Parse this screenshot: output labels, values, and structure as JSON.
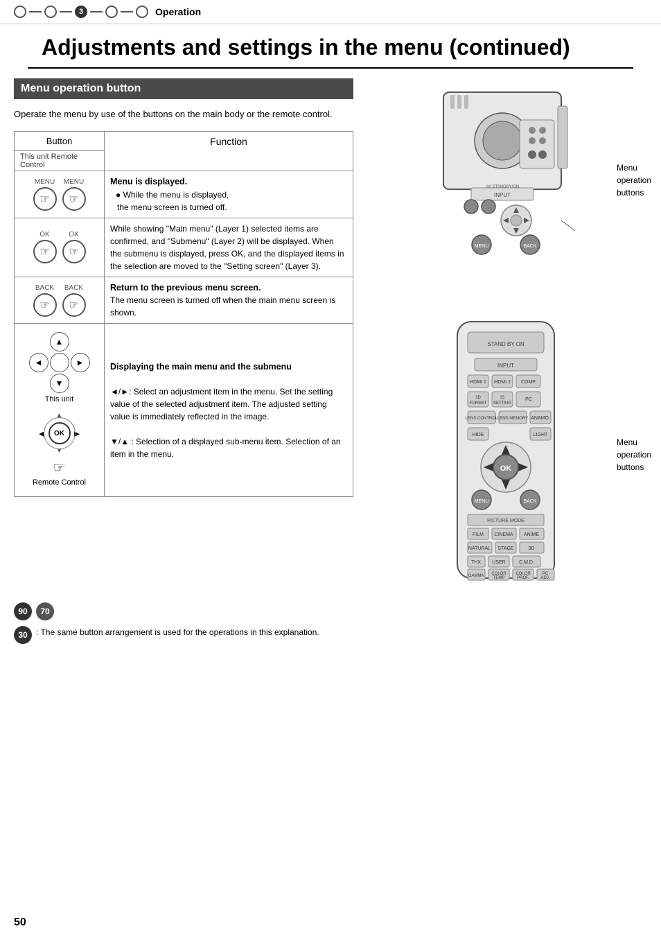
{
  "header": {
    "step_number": "3",
    "title": "Operation"
  },
  "page_title": "Adjustments and settings in the menu (continued)",
  "section_heading": "Menu operation button",
  "intro_text": "Operate the menu by use of the buttons on the main body or the remote control.",
  "table": {
    "col1_header": "Button",
    "col2_header": "Function",
    "sub_header": "This unit Remote Control",
    "rows": [
      {
        "id": "menu-row",
        "button_labels": [
          "MENU",
          "MENU"
        ],
        "function_title": "Menu is displayed.",
        "function_body": "● While the menu is displayed, the menu screen is turned off."
      },
      {
        "id": "ok-row",
        "button_labels": [
          "OK",
          "OK"
        ],
        "function_title": "",
        "function_body": "While showing \"Main menu\" (Layer 1) selected items are confirmed, and \"Submenu\" (Layer 2) will be displayed. When the submenu is displayed, press OK, and the displayed items in the selection are moved to the \"Setting screen\" (Layer 3)."
      },
      {
        "id": "back-row",
        "button_labels": [
          "BACK",
          "BACK"
        ],
        "function_title": "Return to the previous menu screen.",
        "function_body": "The menu screen is turned off when the main menu screen is shown."
      },
      {
        "id": "nav-row",
        "unit_label": "This unit",
        "remote_label": "Remote Control",
        "function_title": "Displaying the main menu and the submenu",
        "function_body_1": "◄/►: Select an adjustment item in the menu. Set the setting value of the selected adjustment item. The adjusted setting value is immediately reflected in the image.",
        "function_body_2": "▼/▲ : Selection of a displayed sub-menu item. Selection of an item in the menu."
      }
    ]
  },
  "right_diagrams": {
    "top_label": "Menu\noperation\nbuttons",
    "bottom_label": "Menu\noperation\nbuttons"
  },
  "bottom_note": {
    "badges": [
      "90",
      "70",
      "30"
    ],
    "note_text": ": The same button arrangement is used for the operations in this explanation."
  },
  "page_number": "50"
}
